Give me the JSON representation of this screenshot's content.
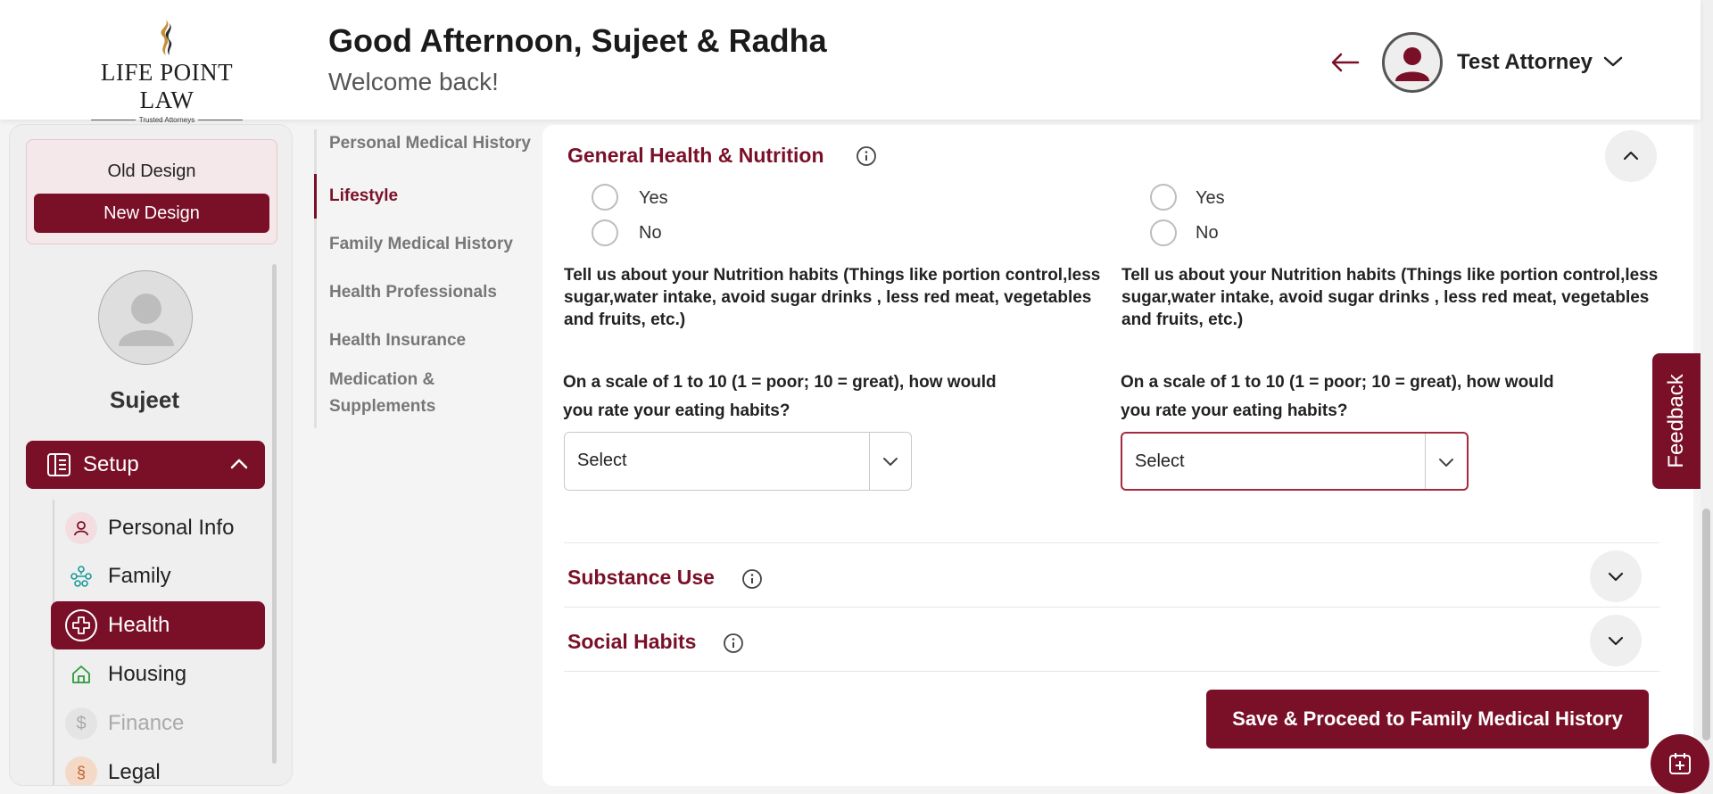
{
  "header": {
    "logo_text": "LIFE POINT LAW",
    "logo_sub": "Trusted Attorneys",
    "greeting": "Good Afternoon, Sujeet & Radha",
    "welcome": "Welcome back!",
    "user_name": "Test Attorney"
  },
  "sidebar": {
    "old_design": "Old Design",
    "new_design": "New Design",
    "profile_name": "Sujeet",
    "setup_label": "Setup",
    "items": [
      {
        "label": "Personal Info",
        "icon": "person-icon"
      },
      {
        "label": "Family",
        "icon": "family-tree-icon"
      },
      {
        "label": "Health",
        "icon": "health-cross-icon",
        "active": true
      },
      {
        "label": "Housing",
        "icon": "house-icon"
      },
      {
        "label": "Finance",
        "icon": "dollar-icon",
        "disabled": true
      },
      {
        "label": "Legal",
        "icon": "legal-icon"
      }
    ]
  },
  "subnav": {
    "items": [
      {
        "label": "Personal Medical History"
      },
      {
        "label": "Lifestyle",
        "active": true
      },
      {
        "label": "Family Medical History"
      },
      {
        "label": "Health Professionals"
      },
      {
        "label": "Health Insurance"
      },
      {
        "label": "Medication &"
      },
      {
        "label": "Supplements"
      }
    ]
  },
  "main": {
    "section_general": "General Health & Nutrition",
    "yes": "Yes",
    "no": "No",
    "nutrition_q": "Tell us about your Nutrition habits (Things like portion control,less sugar,water intake, avoid sugar drinks , less red meat, vegetables and fruits, etc.)",
    "scale_q_line1": "On a scale of 1 to 10 (1 = poor; 10 = great), how would",
    "scale_q_line2": "you rate your eating habits?",
    "select_placeholder": "Select",
    "section_substance": "Substance Use",
    "section_social": "Social Habits",
    "save_button": "Save & Proceed to Family Medical History"
  },
  "feedback": "Feedback",
  "colors": {
    "brand": "#7a1028"
  }
}
